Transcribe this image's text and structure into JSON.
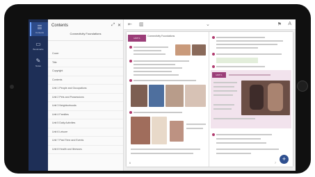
{
  "rail": {
    "items": [
      {
        "icon": "☰",
        "label": "Contents",
        "active": true
      },
      {
        "icon": "▭",
        "label": "Bookmarks",
        "active": false
      },
      {
        "icon": "✎",
        "label": "Notes",
        "active": false
      }
    ]
  },
  "panel": {
    "title": "Contents",
    "subtitle": "Connectivity Foundations",
    "expand_icon": "⤢",
    "close_icon": "✕",
    "toc": [
      "Cover",
      "Title",
      "Copyright",
      "Contents",
      "Unit 1 People and Occupations",
      "Unit 2 Pets and Possessions",
      "Unit 3 Neighborhoods",
      "Unit 4 Families",
      "Unit 5 Daily Activities",
      "Unit 6 Leisure",
      "Unit 7 Past Time and Events",
      "Unit 8 Health and Illnesses"
    ]
  },
  "toolbar": {
    "back_icon": "⇤",
    "layout_icon": "▥",
    "dropdown_icon": "⌄",
    "bookmark_icon": "⚑",
    "text_icon": "A"
  },
  "book": {
    "left_banner": "UNIT 1",
    "left_heading": "Connectivity Foundations",
    "right_tag": "UNIT 1",
    "left_page_num": "6",
    "right_page_num": "7",
    "fab_label": "+"
  },
  "colors": {
    "rail": "#1e2f57",
    "accent": "#9b3d78",
    "fab": "#2e4f8f"
  }
}
